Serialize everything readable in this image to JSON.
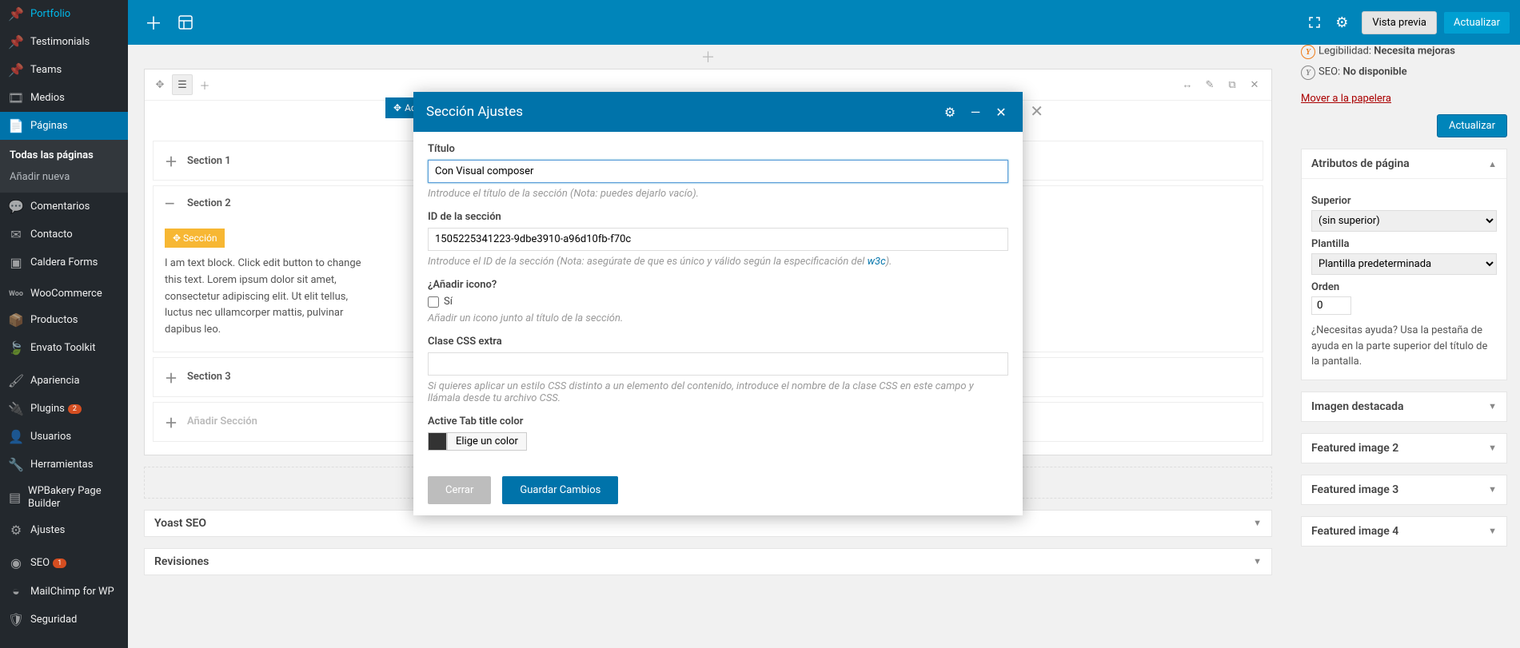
{
  "sidebar": {
    "items": [
      {
        "label": "Portfolio",
        "icon": "pin"
      },
      {
        "label": "Testimonials",
        "icon": "pin"
      },
      {
        "label": "Teams",
        "icon": "pin"
      },
      {
        "label": "Medios",
        "icon": "media"
      },
      {
        "label": "Páginas",
        "icon": "page",
        "current": true,
        "submenu": [
          {
            "label": "Todas las páginas",
            "current": true
          },
          {
            "label": "Añadir nueva"
          }
        ]
      },
      {
        "label": "Comentarios",
        "icon": "comment"
      },
      {
        "label": "Contacto",
        "icon": "mail"
      },
      {
        "label": "Caldera Forms",
        "icon": "form"
      },
      {
        "label": "WooCommerce",
        "icon": "woo"
      },
      {
        "label": "Productos",
        "icon": "product"
      },
      {
        "label": "Envato Toolkit",
        "icon": "envato"
      },
      {
        "label": "Apariencia",
        "icon": "brush"
      },
      {
        "label": "Plugins",
        "icon": "plug",
        "badge": "2"
      },
      {
        "label": "Usuarios",
        "icon": "user"
      },
      {
        "label": "Herramientas",
        "icon": "tools"
      },
      {
        "label": "WPBakery Page Builder",
        "icon": "vc"
      },
      {
        "label": "Ajustes",
        "icon": "settings"
      },
      {
        "label": "SEO",
        "icon": "seo",
        "badge": "1"
      },
      {
        "label": "MailChimp for WP",
        "icon": "mc"
      },
      {
        "label": "Seguridad",
        "icon": "shield"
      }
    ]
  },
  "topbar": {
    "preview": "Vista previa",
    "update": "Actualizar"
  },
  "editor": {
    "acordeon_tag": "Acordeó",
    "sections": [
      {
        "title": "Section 1",
        "open": false
      },
      {
        "title": "Section 2",
        "open": true,
        "inner_tag": "Sección",
        "text": "I am text block. Click edit button to change this text. Lorem ipsum dolor sit amet, consectetur adipiscing elit. Ut elit tellus, luctus nec ullamcorper mattis, pulvinar dapibus leo."
      },
      {
        "title": "Section 3",
        "open": false
      }
    ],
    "add_section": "Añadir Sección",
    "yoast": "Yoast SEO",
    "revisiones": "Revisiones"
  },
  "right": {
    "legibilidad_label": "Legibilidad:",
    "legibilidad_value": "Necesita mejoras",
    "seo_label": "SEO:",
    "seo_value": "No disponible",
    "trash": "Mover a la papelera",
    "actualizar": "Actualizar",
    "atributos": {
      "title": "Atributos de página",
      "superior_label": "Superior",
      "superior_value": "(sin superior)",
      "plantilla_label": "Plantilla",
      "plantilla_value": "Plantilla predeterminada",
      "orden_label": "Orden",
      "orden_value": "0",
      "help": "¿Necesitas ayuda? Usa la pestaña de ayuda en la parte superior del título de la pantalla."
    },
    "boxes": [
      {
        "title": "Imagen destacada"
      },
      {
        "title": "Featured image 2"
      },
      {
        "title": "Featured image 3"
      },
      {
        "title": "Featured image 4"
      }
    ]
  },
  "modal": {
    "title": "Sección Ajustes",
    "titulo_label": "Título",
    "titulo_value": "Con Visual composer",
    "titulo_hint": "Introduce el título de la sección (Nota: puedes dejarlo vacío).",
    "id_label": "ID de la sección",
    "id_value": "1505225341223-9dbe3910-a96d10fb-f70c",
    "id_hint_pre": "Introduce el ID de la sección (Nota: asegúrate de que es único y válido según la especificación del ",
    "id_hint_link": "w3c",
    "id_hint_post": ").",
    "icono_label": "¿Añadir icono?",
    "icono_chk": "Sí",
    "icono_hint": "Añadir un icono junto al título de la sección.",
    "css_label": "Clase CSS extra",
    "css_hint": "Si quieres aplicar un estilo CSS distinto a un elemento del contenido, introduce el nombre de la clase CSS en este campo y llámala desde tu archivo CSS.",
    "color_label": "Active Tab title color",
    "color_btn": "Elige un color",
    "cerrar": "Cerrar",
    "guardar": "Guardar Cambios"
  }
}
